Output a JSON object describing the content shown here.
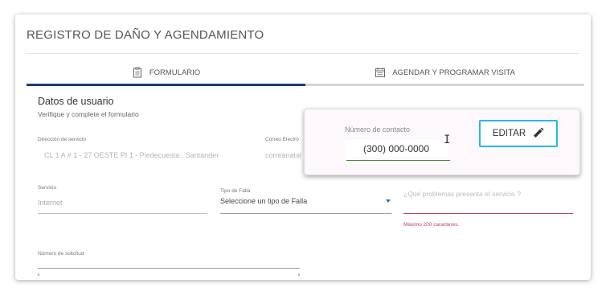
{
  "page": {
    "title": "REGISTRO DE DAÑO Y AGENDAMIENTO"
  },
  "tabs": [
    {
      "label": "FORMULARIO",
      "icon": "clipboard-icon",
      "active": true
    },
    {
      "label": "AGENDAR Y PROGRAMAR VISITA",
      "icon": "calendar-icon",
      "active": false
    }
  ],
  "section": {
    "title": "Datos de usuario",
    "subtitle": "Verifique y complete el formulario"
  },
  "fields": {
    "service_address": {
      "label": "Dirección de servicio",
      "value": "CL 1 A # 1 - 27 OESTE PI 1 - Piedecuesta , Santander"
    },
    "email": {
      "label": "Correo Electró",
      "value": "correanatal"
    },
    "service": {
      "label": "Servicio",
      "value": "Internet"
    },
    "fault_type": {
      "label": "Tipo de Falla",
      "value": "Seleccione un tipo de Falla"
    },
    "problem": {
      "placeholder": "¿Qué problemas presenta el servicio ?",
      "hint": "Máximo 200 caracteres."
    },
    "request_number": {
      "label": "Número de solicitud"
    }
  },
  "popup": {
    "contact_label": "Número de contacto",
    "contact_value": "(300) 000-0000",
    "cursor_glyph": "I",
    "edit_label": "EDITAR",
    "edit_icon": "pencil-icon"
  },
  "colors": {
    "tab_active": "#1b3c6e",
    "edit_border": "#29b6e6",
    "error": "#b5475a",
    "contact_underline": "#4b8a3c",
    "dropdown_arrow": "#3a6bb0"
  }
}
